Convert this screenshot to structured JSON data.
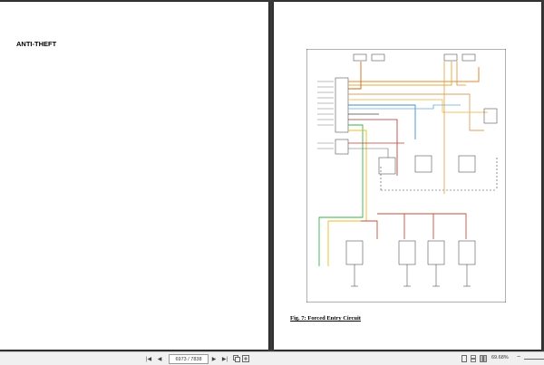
{
  "left_page": {
    "title": "ANTI-THEFT"
  },
  "right_page": {
    "caption": "Fig. 7: Forced Entry Circuit"
  },
  "toolbar": {
    "first_page_icon": "skip-to-start-icon",
    "prev_page_icon": "prev-page-icon",
    "page_indicator": "6973 / 7838",
    "next_page_icon": "next-page-icon",
    "last_page_icon": "skip-to-end-icon",
    "zoom_level": "69.68%",
    "zoom_minus": "−"
  }
}
